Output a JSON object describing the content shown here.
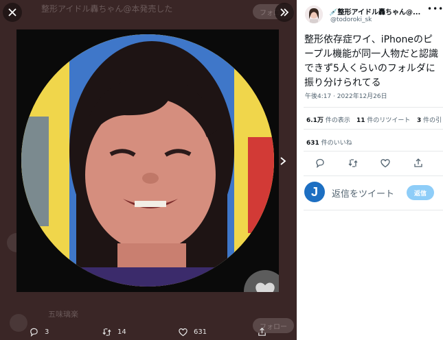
{
  "background": {
    "header_text": "整形アイドル轟ちゃん@本発売した",
    "follow_label": "フォロー",
    "follow_label_2": "フォロー",
    "bottom_user": "五味璃楽"
  },
  "viewer": {
    "close_icon": "close-icon",
    "expand_icon": "expand-icon",
    "next_icon": "chevron-right-icon",
    "image_description_icon": "heart-icon"
  },
  "bottom_bar": {
    "reply_count": "3",
    "retweet_count": "14",
    "like_count": "631"
  },
  "tweet": {
    "author_name": "💉整形アイドル轟ちゃん@...",
    "author_handle": "@todoroki_sk",
    "text": "整形依存症ワイ、iPhoneのピープル機能が同一人物だと認識できず5人くらいのフォルダに振り分けられてる",
    "timestamp": "午後4:17 · 2022年12月26日",
    "stats": [
      {
        "num": "6.1万",
        "label": " 件の表示"
      },
      {
        "num": "11",
        "label": " 件のリツイート"
      },
      {
        "num": "3",
        "label": " 件の引"
      }
    ],
    "likes_num": "631",
    "likes_label": " 件のいいね",
    "reply_placeholder": "返信をツイート",
    "reply_button": "返信",
    "reply_avatar_letter": "J"
  },
  "colors": {
    "accent": "#1d9bf0",
    "reply_button_disabled": "#8ecdf8",
    "avatar_blue": "#1d6fc2"
  }
}
